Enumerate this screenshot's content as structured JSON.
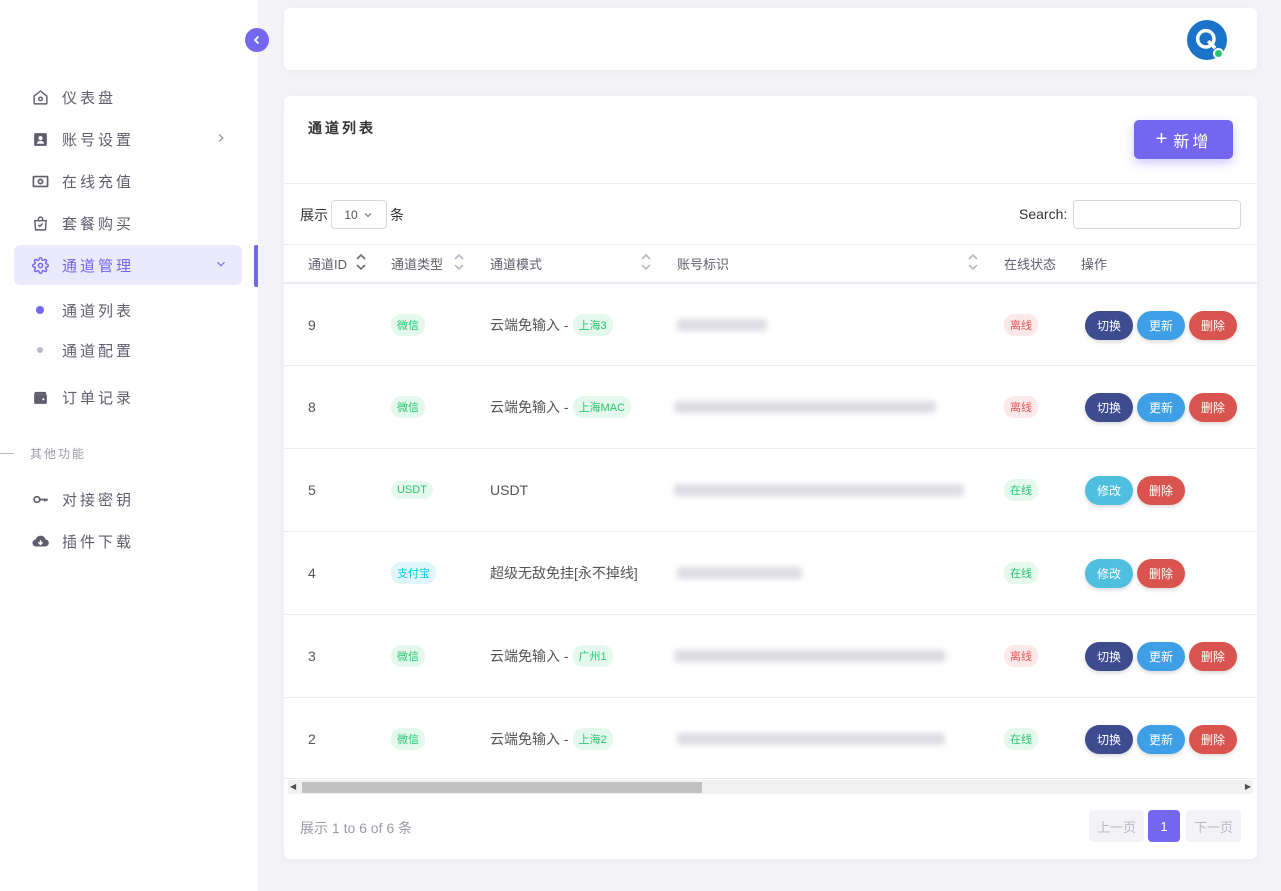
{
  "sidebar": {
    "items": [
      {
        "label": "仪表盘",
        "icon": "home-icon"
      },
      {
        "label": "账号设置",
        "icon": "user-card-icon"
      },
      {
        "label": "在线充值",
        "icon": "money-icon"
      },
      {
        "label": "套餐购买",
        "icon": "shopping-bag-icon"
      },
      {
        "label": "通道管理",
        "icon": "gear-icon"
      },
      {
        "label": "订单记录",
        "icon": "wallet-icon"
      }
    ],
    "sub_items": [
      "通道列表",
      "通道配置"
    ],
    "section_label": "其他功能",
    "other_items": [
      {
        "label": "对接密钥",
        "icon": "key-icon"
      },
      {
        "label": "插件下载",
        "icon": "cloud-download-icon"
      }
    ]
  },
  "card": {
    "title": "通道列表",
    "add_button": "新增",
    "add_plus": "+"
  },
  "table_controls": {
    "show_prefix": "展示",
    "page_length": "10",
    "show_suffix": "条",
    "search_label": "Search:",
    "search_value": ""
  },
  "table": {
    "headers": [
      "通道ID",
      "通道类型",
      "通道模式",
      "账号标识",
      "在线状态",
      "操作"
    ],
    "rows": [
      {
        "id": "9",
        "type": "微信",
        "type_color": "green",
        "mode": "云端免输入 -",
        "mode_badge": "上海3",
        "status": "离线",
        "status_color": "red",
        "actions": [
          "切换",
          "更新",
          "删除"
        ]
      },
      {
        "id": "8",
        "type": "微信",
        "type_color": "green",
        "mode": "云端免输入 -",
        "mode_badge": "上海MAC",
        "status": "离线",
        "status_color": "red",
        "actions": [
          "切换",
          "更新",
          "删除"
        ]
      },
      {
        "id": "5",
        "type": "USDT",
        "type_color": "green",
        "mode": "USDT",
        "mode_badge": "",
        "status": "在线",
        "status_color": "green",
        "actions": [
          "修改",
          "删除"
        ]
      },
      {
        "id": "4",
        "type": "支付宝",
        "type_color": "blue",
        "mode": "超级无敌免挂[永不掉线]",
        "mode_badge": "",
        "status": "在线",
        "status_color": "green",
        "actions": [
          "修改",
          "删除"
        ]
      },
      {
        "id": "3",
        "type": "微信",
        "type_color": "green",
        "mode": "云端免输入 -",
        "mode_badge": "广州1",
        "status": "离线",
        "status_color": "red",
        "actions": [
          "切换",
          "更新",
          "删除"
        ]
      },
      {
        "id": "2",
        "type": "微信",
        "type_color": "green",
        "mode": "云端免输入 -",
        "mode_badge": "上海2",
        "status": "在线",
        "status_color": "green",
        "actions": [
          "切换",
          "更新",
          "删除"
        ]
      }
    ]
  },
  "footer": {
    "info": "展示 1 to 6 of 6 条",
    "prev": "上一页",
    "page": "1",
    "next": "下一页"
  },
  "colors": {
    "accent": "#7367f0",
    "switch": "#3d4b8f",
    "update": "#3e9ee6",
    "delete": "#d9534f",
    "edit": "#4fbfe0"
  }
}
